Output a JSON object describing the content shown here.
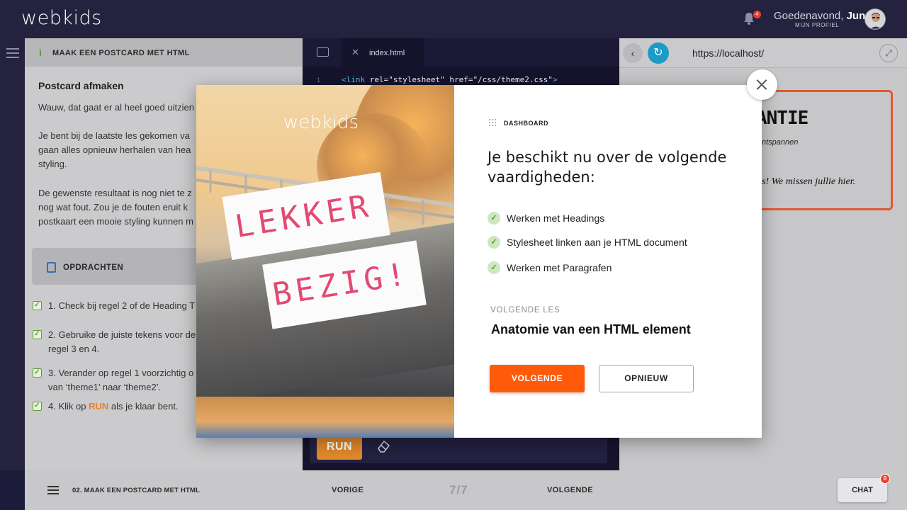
{
  "header": {
    "logo": "webkids",
    "notifications_count": "4",
    "greeting": "Goedenavond,",
    "user_name": "Jun",
    "profile_label": "MIJN PROFIEL"
  },
  "lesson": {
    "title": "MAAK EEN POSTCARD MET HTML",
    "subtitle": "Postcard afmaken",
    "paragraphs": [
      [
        "Wauw, dat gaat er al heel goed uitzien"
      ],
      [
        "Je bent bij de laatste les gekomen va",
        "gaan alles opnieuw herhalen van hea",
        "styling."
      ],
      [
        "De gewenste resultaat is nog niet te z",
        "nog wat fout. Zou je de fouten eruit k",
        "postkaart een mooie styling kunnen m"
      ]
    ],
    "tasks_label": "OPDRACHTEN",
    "tasks": [
      {
        "line1": "1. Check bij regel 2 of de Heading T",
        "line2": ""
      },
      {
        "line1": "2. Gebruike de juiste tekens voor de",
        "line2": "regel 3 en 4."
      },
      {
        "line1": "3. Verander op regel 1 voorzichtig o",
        "line2": "van ‘theme1’ naar ‘theme2’."
      },
      {
        "line1": "4. Klik op ",
        "run": "RUN",
        "after": " als je klaar bent.",
        "line2": ""
      }
    ]
  },
  "editor": {
    "file_name": "index.html",
    "line_number": "1",
    "code_tag": "<link",
    "code_attr": " rel=\"stylesheet\" href=\"/css/theme2.css\"",
    "code_end": ">",
    "run_label": "RUN"
  },
  "preview": {
    "url": "https://localhost/",
    "title_partial": "ANTIE",
    "subtitle_partial": "ntspannen",
    "message_partial": "s! We missen jullie hier."
  },
  "footer": {
    "lesson_label": "02. MAAK EEN POSTCARD MET HTML",
    "prev_label": "VORIGE",
    "page": "7/7",
    "next_label": "VOLGENDE",
    "chat_label": "CHAT",
    "chat_count": "0"
  },
  "modal": {
    "art_logo": "webkids",
    "art_word1": "LEKKER",
    "art_word2": "BEZIG!",
    "breadcrumb": "DASHBOARD",
    "heading": "Je beschikt nu over de volgende vaardigheden:",
    "skills": [
      "Werken met Headings",
      "Stylesheet linken aan je HTML document",
      "Werken met Paragrafen"
    ],
    "next_lesson_label": "VOLGENDE LES",
    "next_lesson_title": "Anatomie van een HTML element",
    "next_button": "VOLGENDE",
    "retry_button": "OPNIEUW"
  },
  "colors": {
    "accent_orange": "#ff5a0a",
    "check_green": "#5aa02c",
    "reload_blue": "#1d9bc6",
    "postcard_border": "#e4572e",
    "art_text_pink": "#e24a73",
    "topbar": "#24223f"
  },
  "icons": [
    "bell-icon",
    "avatar",
    "hamburger-icon",
    "info-icon",
    "clipboard-icon",
    "checkbox-icon",
    "folder-icon",
    "close-tab-icon",
    "eraser-icon",
    "back-arrow-icon",
    "reload-icon",
    "expand-icon",
    "dashboard-grid-icon",
    "check-circle-icon",
    "close-icon"
  ]
}
